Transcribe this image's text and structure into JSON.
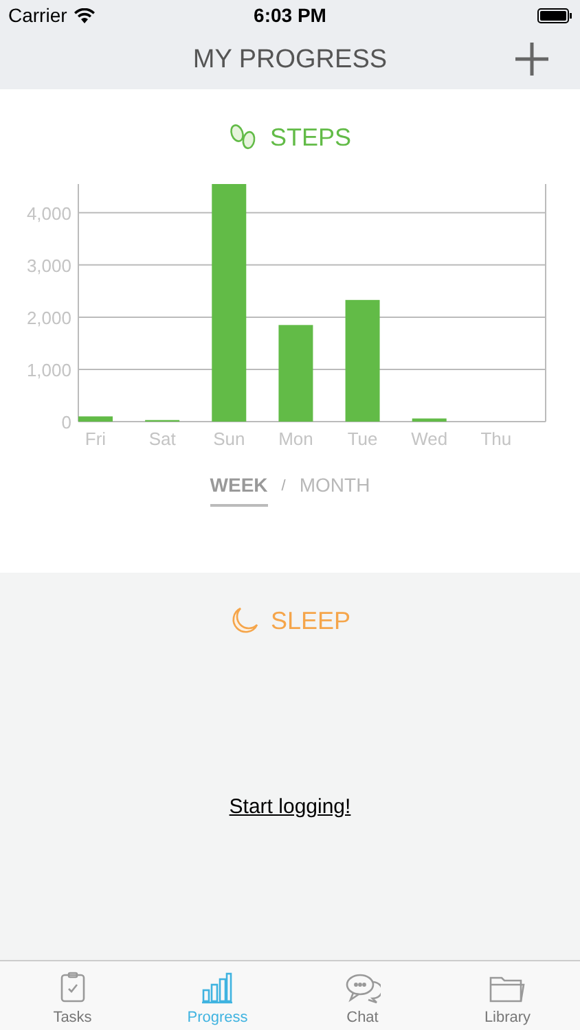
{
  "status_bar": {
    "carrier": "Carrier",
    "time": "6:03 PM"
  },
  "nav": {
    "title": "MY PROGRESS"
  },
  "steps": {
    "title": "STEPS",
    "chart_data": {
      "type": "bar",
      "categories": [
        "Fri",
        "Sat",
        "Sun",
        "Mon",
        "Tue",
        "Wed",
        "Thu"
      ],
      "grid": true,
      "series": [
        {
          "color": "#62bb47",
          "values": [
            100,
            30,
            4550,
            1850,
            2330,
            60,
            0
          ]
        }
      ],
      "ylim": [
        0,
        4550
      ],
      "yticks": [
        {
          "value": 0,
          "label": "0"
        },
        {
          "value": 1000,
          "label": "1,000"
        },
        {
          "value": 2000,
          "label": "2,000"
        },
        {
          "value": 3000,
          "label": "3,000"
        },
        {
          "value": 4000,
          "label": "4,000"
        }
      ]
    },
    "periods": [
      {
        "label": "WEEK",
        "selected": true
      },
      {
        "label": "MONTH",
        "selected": false
      }
    ],
    "separator": "/"
  },
  "sleep": {
    "title": "SLEEP",
    "link": "Start logging!"
  },
  "tabs": [
    {
      "label": "Tasks",
      "kind": "tasks",
      "selected": false
    },
    {
      "label": "Progress",
      "kind": "progress",
      "selected": true
    },
    {
      "label": "Chat",
      "kind": "chat",
      "selected": false
    },
    {
      "label": "Library",
      "kind": "library",
      "selected": false
    }
  ]
}
